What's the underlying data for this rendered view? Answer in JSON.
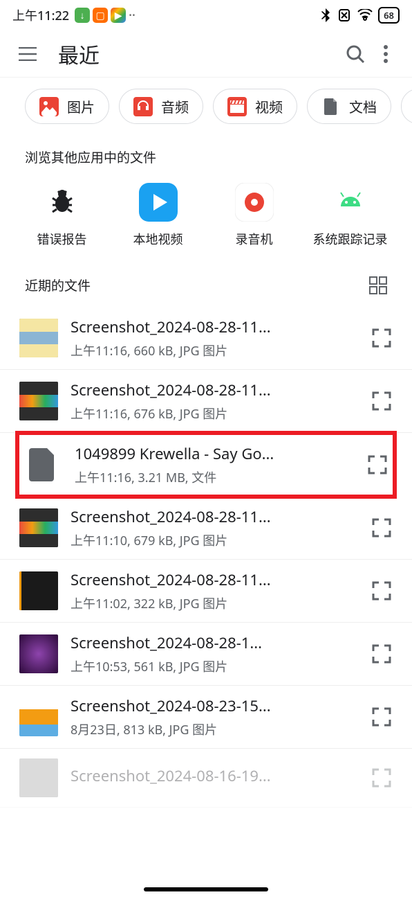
{
  "statusbar": {
    "time": "上午11:22",
    "battery": "68"
  },
  "appbar": {
    "title": "最近"
  },
  "chips": [
    {
      "label": "图片",
      "color": "#ea4335",
      "icon": "image"
    },
    {
      "label": "音频",
      "color": "#ea4335",
      "icon": "headphone"
    },
    {
      "label": "视频",
      "color": "#ea4335",
      "icon": "clapper"
    },
    {
      "label": "文档",
      "color": "#5f6368",
      "icon": "doc"
    }
  ],
  "section_browse": "浏览其他应用中的文件",
  "apps": [
    {
      "label": "错误报告",
      "color": "#202124",
      "icon": "bug"
    },
    {
      "label": "本地视频",
      "color": "#1aa1f1",
      "icon": "play"
    },
    {
      "label": "录音机",
      "color": "#ffffff",
      "icon": "rec"
    },
    {
      "label": "系统跟踪记录",
      "color": "transparent",
      "icon": "android"
    }
  ],
  "recent_header": "近期的文件",
  "files": [
    {
      "name": "Screenshot_2024-08-28-11...",
      "meta": "上午11:16, 660 kB, JPG 图片",
      "thumb": "screenshot-light",
      "highlight": false
    },
    {
      "name": "Screenshot_2024-08-28-11...",
      "meta": "上午11:16, 676 kB, JPG 图片",
      "thumb": "screenshot-dark",
      "highlight": false
    },
    {
      "name": "1049899 Krewella - Say Go...",
      "meta": "上午11:16, 3.21 MB, 文件",
      "thumb": "docfile",
      "highlight": true
    },
    {
      "name": "Screenshot_2024-08-28-11...",
      "meta": "上午11:10, 679 kB, JPG 图片",
      "thumb": "screenshot-dark",
      "highlight": false
    },
    {
      "name": "Screenshot_2024-08-28-11...",
      "meta": "上午11:02, 322 kB, JPG 图片",
      "thumb": "screenshot-black",
      "highlight": false
    },
    {
      "name": "Screenshot_2024-08-28-1...",
      "meta": "上午10:53, 561 kB, JPG 图片",
      "thumb": "screenshot-purple",
      "highlight": false
    },
    {
      "name": "Screenshot_2024-08-23-15...",
      "meta": "8月23日, 813 kB, JPG 图片",
      "thumb": "screenshot-orange",
      "highlight": false
    },
    {
      "name": "Screenshot_2024-08-16-19...",
      "meta": "",
      "thumb": "screenshot-fade",
      "highlight": false
    }
  ]
}
